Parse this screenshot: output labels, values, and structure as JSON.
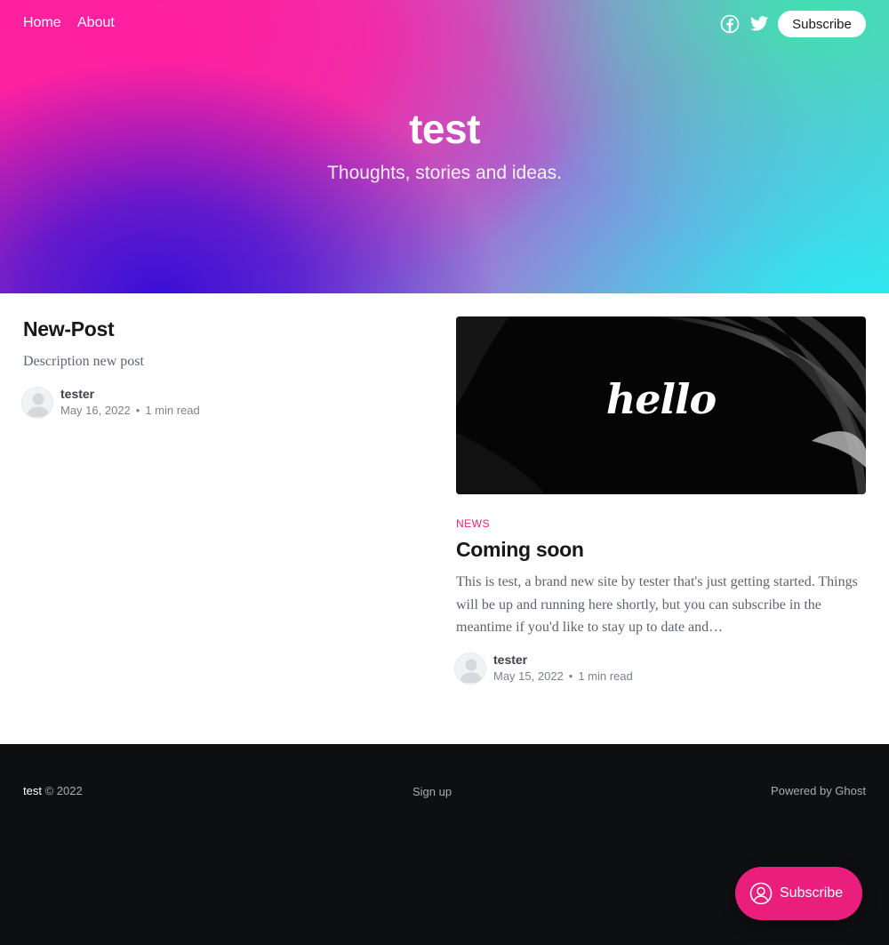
{
  "nav": {
    "home": "Home",
    "about": "About",
    "subscribe": "Subscribe"
  },
  "site": {
    "title": "test",
    "description": "Thoughts, stories and ideas."
  },
  "posts": [
    {
      "title": "New-Post",
      "excerpt": "Description new post",
      "author": "tester",
      "date": "May 16, 2022",
      "reading_time": "1 min read"
    },
    {
      "tag": "NEWS",
      "title": "Coming soon",
      "image_text": "hello",
      "excerpt": "This is test, a brand new site by tester that's just getting started. Things will be up and running here shortly, but you can subscribe in the meantime if you'd like to stay up to date and…",
      "author": "tester",
      "date": "May 15, 2022",
      "reading_time": "1 min read"
    }
  ],
  "footer": {
    "site": "test",
    "copyright": "© 2022",
    "signup": "Sign up",
    "powered": "Powered by Ghost"
  },
  "portal": {
    "label": "Subscribe"
  },
  "colors": {
    "accent": "#ea1f7d",
    "footer_bg": "#0e0f11"
  },
  "icons": [
    "facebook-icon",
    "twitter-icon",
    "person-icon"
  ]
}
